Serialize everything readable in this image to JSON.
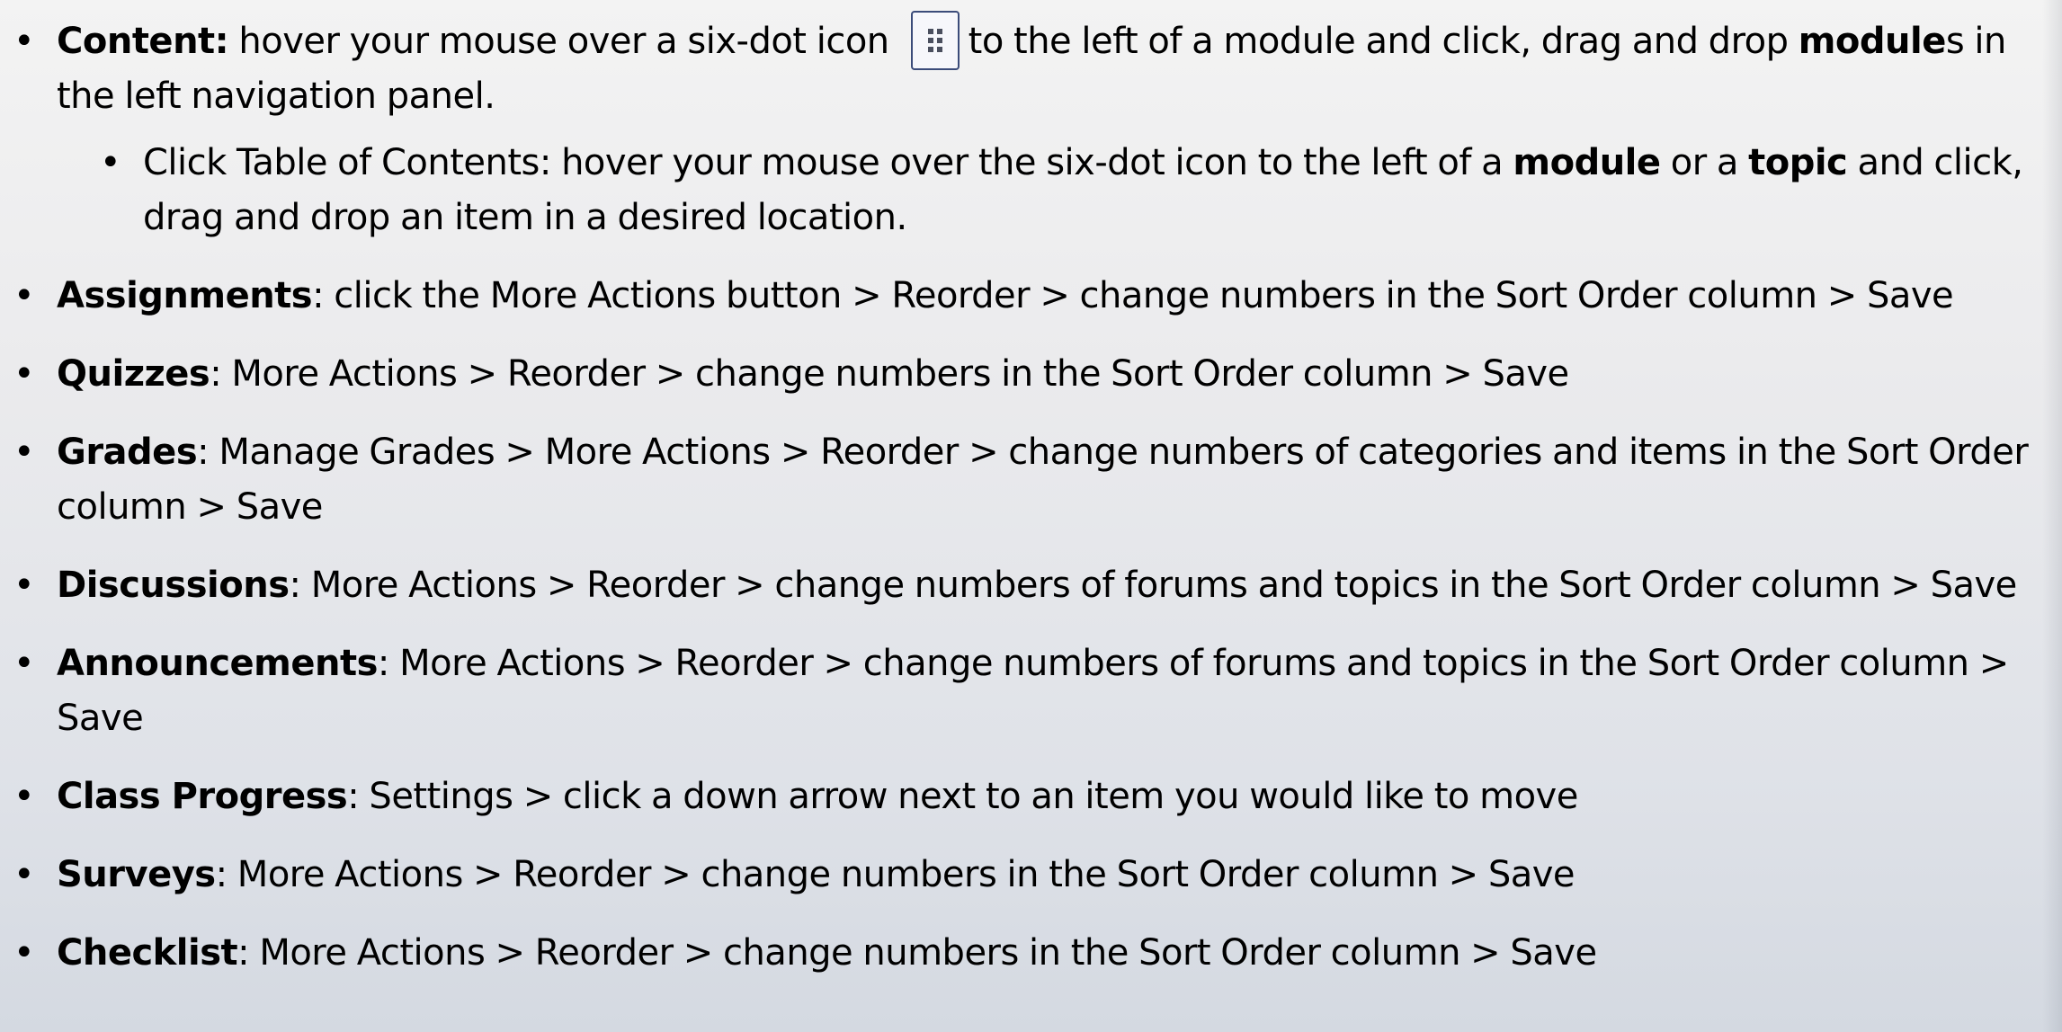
{
  "items": [
    {
      "bold": "Content:",
      "text_a": " hover your mouse over a six-dot icon",
      "icon": "six-dot-drag-handle-icon",
      "text_b": "to the left of a module and click, drag and drop ",
      "bold_b": "module",
      "text_c": "s in the left navigation panel.",
      "sub": {
        "text_a": "Click Table of Contents: hover your mouse over the six-dot icon to the left of a ",
        "bold_a": "module",
        "text_b": " or a ",
        "bold_b": "topic",
        "text_c": " and click, drag and drop an item in a desired location."
      }
    },
    {
      "bold": "Assignments",
      "text": ": click the More Actions button > Reorder >  change numbers in the Sort Order column > Save"
    },
    {
      "bold": "Quizzes",
      "text": ": More Actions > Reorder >  change numbers in the Sort Order column > Save"
    },
    {
      "bold": "Grades",
      "text": ": Manage Grades > More Actions > Reorder >  change numbers of categories and items in the Sort Order column > Save"
    },
    {
      "bold": "Discussions",
      "text": ": More Actions > Reorder >  change numbers of forums and topics in the Sort Order column > Save"
    },
    {
      "bold": "Announcements",
      "text": ": More Actions > Reorder >  change numbers of forums and topics in the Sort Order column > Save"
    },
    {
      "bold": "Class Progress",
      "text": ": Settings > click a down arrow next to an item you would like to move"
    },
    {
      "bold": "Surveys",
      "text": ": More Actions > Reorder >  change numbers in the Sort Order column > Save"
    },
    {
      "bold": "Checklist",
      "text": ": More Actions > Reorder >  change numbers in the Sort Order column > Save"
    }
  ]
}
